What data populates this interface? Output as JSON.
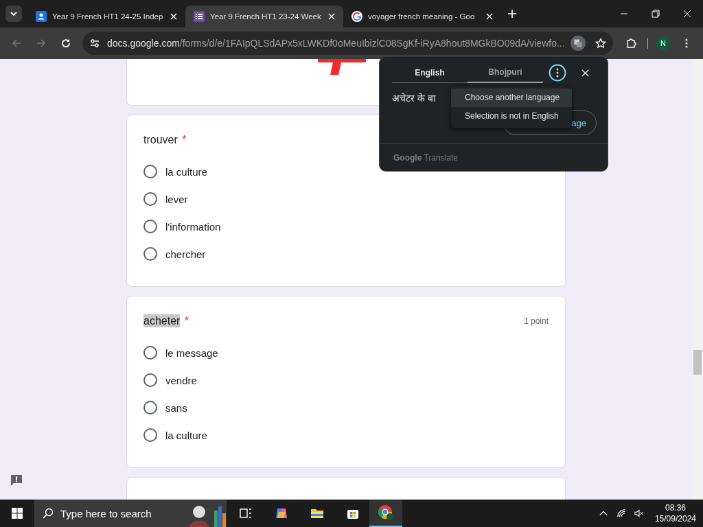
{
  "browser": {
    "tabs": [
      {
        "title": "Year 9 French HT1 24-25 Indep",
        "selected": false
      },
      {
        "title": "Year 9 French HT1 23-24 Week",
        "selected": true
      },
      {
        "title": "voyager french meaning - Goo",
        "selected": false
      }
    ],
    "url_host": "docs.google.com",
    "url_path": "/forms/d/e/1FAIpQLSdAPx5xLWKDf0oMeuIbizlC08SgKf-iRyA8hout8MGkBO09dA/viewfo...",
    "profile": "N"
  },
  "questions": [
    {
      "title": "trouver",
      "required": "*",
      "highlighted": false,
      "options": [
        {
          "label": "la culture",
          "selected": false
        },
        {
          "label": "lever",
          "selected": false
        },
        {
          "label": "l'information",
          "selected": false
        },
        {
          "label": "chercher",
          "selected": false
        }
      ]
    },
    {
      "title": "acheter",
      "required": "*",
      "points": "1 point",
      "highlighted": true,
      "options": [
        {
          "label": "le message",
          "selected": false
        },
        {
          "label": "vendre",
          "selected": false
        },
        {
          "label": "sans",
          "selected": false
        },
        {
          "label": "la culture",
          "selected": false
        }
      ]
    }
  ],
  "translate": {
    "tabs": [
      {
        "label": "English",
        "selected": false
      },
      {
        "label": "Bhojpuri",
        "selected": true
      }
    ],
    "text": "अचेटर के बा",
    "button": "age",
    "footer_brand": "Google",
    "footer_product": "Translate",
    "menu": [
      {
        "label": "Choose another language",
        "selected": true
      },
      {
        "label": "Selection is not in English",
        "selected": false
      }
    ]
  },
  "taskbar": {
    "search_placeholder": "Type here to search",
    "time": "08:36",
    "date": "15/09/2024"
  }
}
